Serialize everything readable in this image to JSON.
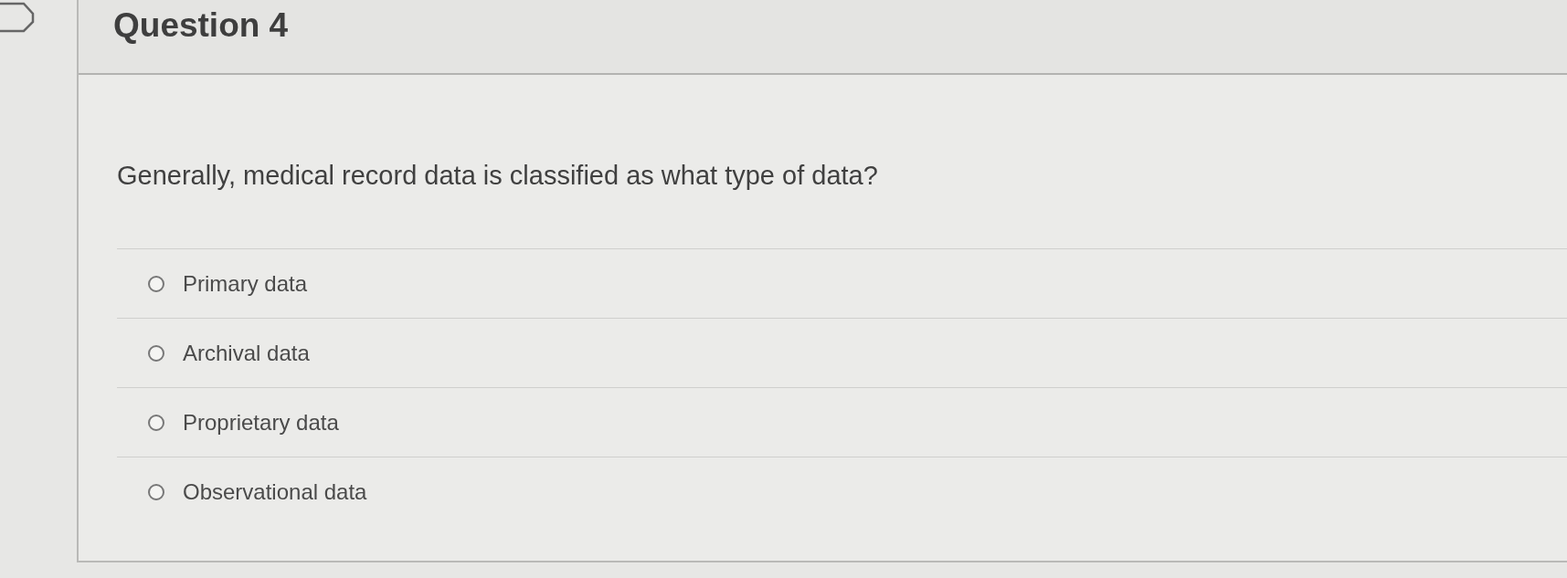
{
  "question": {
    "title": "Question 4",
    "flagged": false,
    "text": "Generally, medical record data is classified as what type of data?"
  },
  "answers": [
    {
      "label": "Primary data",
      "selected": false
    },
    {
      "label": "Archival data",
      "selected": false
    },
    {
      "label": "Proprietary data",
      "selected": false
    },
    {
      "label": "Observational data",
      "selected": false
    }
  ]
}
